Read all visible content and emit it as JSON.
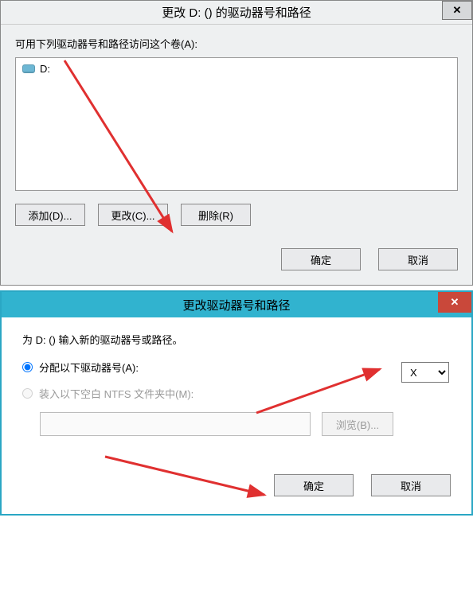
{
  "dialog1": {
    "title": "更改 D: () 的驱动器号和路径",
    "close": "✕",
    "instruction": "可用下列驱动器号和路径访问这个卷(A):",
    "drive_label": "D:",
    "buttons": {
      "add": "添加(D)...",
      "change": "更改(C)...",
      "remove": "删除(R)"
    },
    "ok": "确定",
    "cancel": "取消"
  },
  "dialog2": {
    "title": "更改驱动器号和路径",
    "close": "✕",
    "instruction": "为 D: () 输入新的驱动器号或路径。",
    "radio_assign": "分配以下驱动器号(A):",
    "drive_selected": "X",
    "radio_mount": "装入以下空白 NTFS 文件夹中(M):",
    "mount_path": "",
    "browse": "浏览(B)...",
    "ok": "确定",
    "cancel": "取消"
  },
  "annotations": {
    "arrow_color": "#e03030"
  }
}
